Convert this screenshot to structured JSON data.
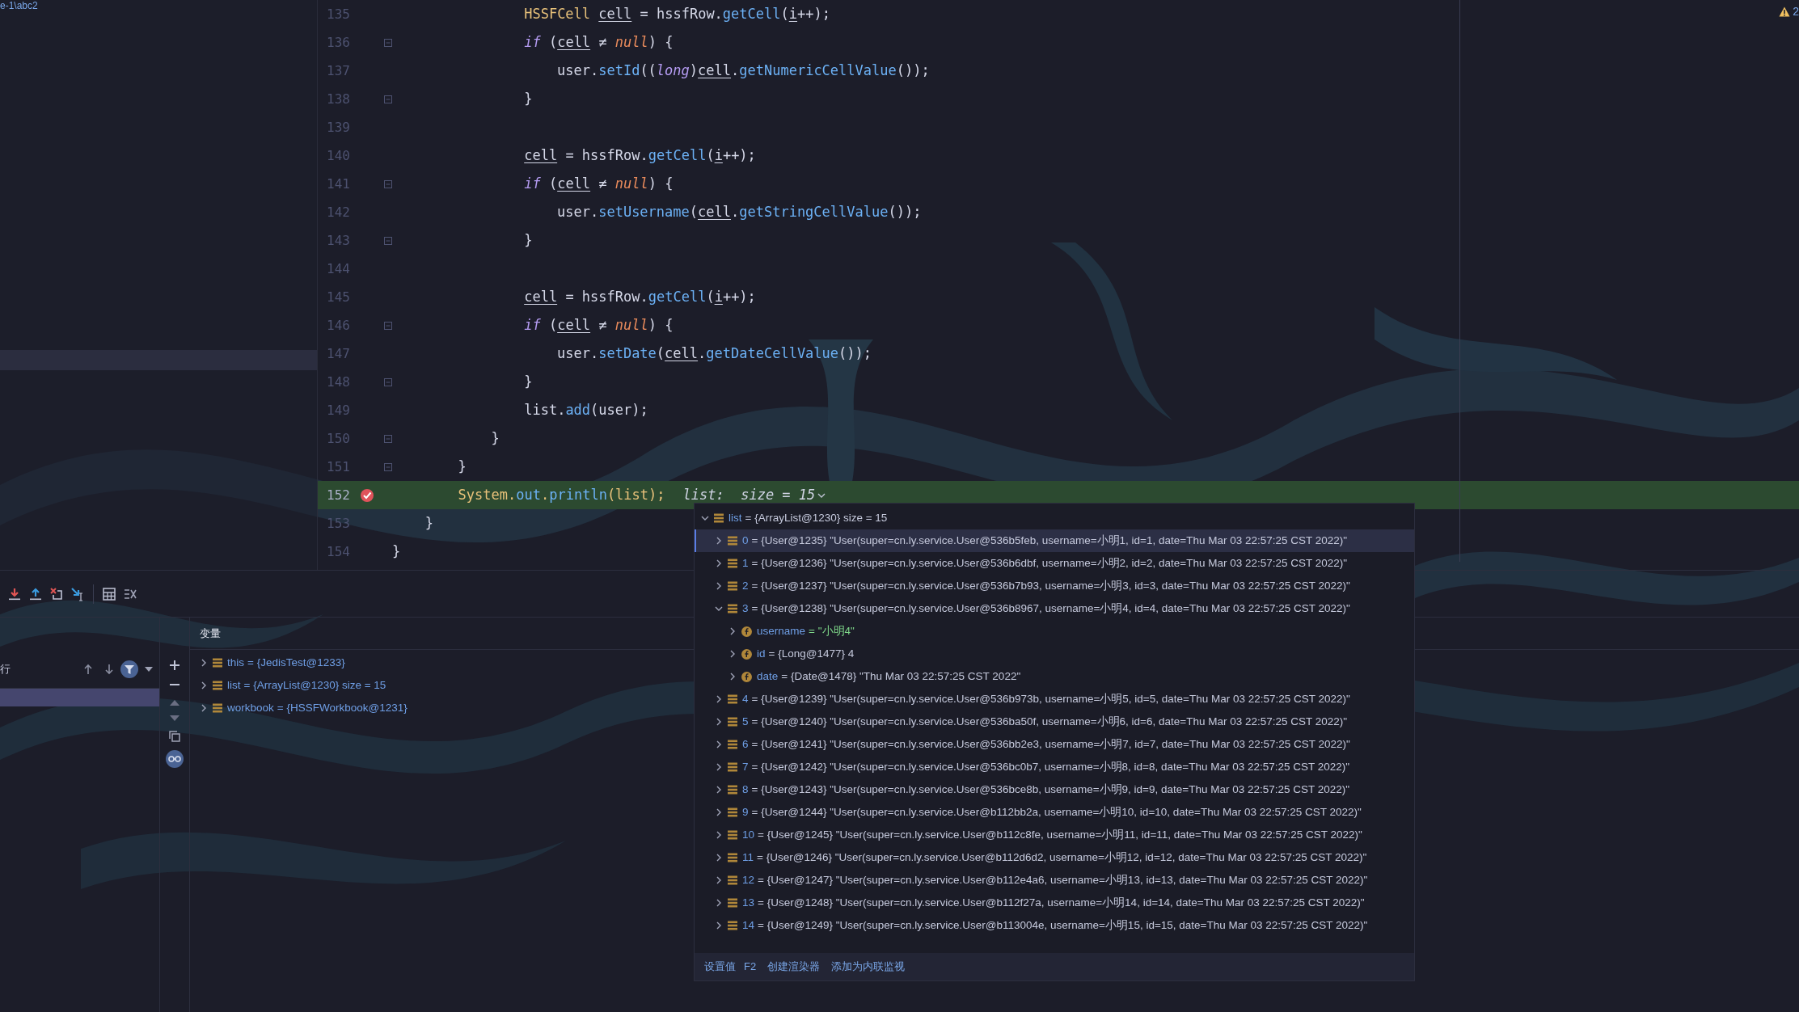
{
  "project_panel": {
    "path_text": "e-1\\abc2"
  },
  "editor": {
    "warning_count": "2",
    "lines": [
      {
        "number": "135",
        "fold": false,
        "breakpoint": false,
        "current": false,
        "tokens": [
          {
            "kind": "type",
            "text": "                HSSFCell "
          },
          {
            "kind": "var",
            "text": "cell"
          },
          {
            "kind": "plain",
            "text": " = hssfRow."
          },
          {
            "kind": "method",
            "text": "getCell"
          },
          {
            "kind": "plain",
            "text": "("
          },
          {
            "kind": "var",
            "text": "i"
          },
          {
            "kind": "plain",
            "text": "++);"
          }
        ]
      },
      {
        "number": "136",
        "fold": true,
        "breakpoint": false,
        "current": false,
        "tokens": [
          {
            "kind": "kw",
            "text": "                if"
          },
          {
            "kind": "plain",
            "text": " ("
          },
          {
            "kind": "var",
            "text": "cell"
          },
          {
            "kind": "plain",
            "text": " ≠ "
          },
          {
            "kind": "null",
            "text": "null"
          },
          {
            "kind": "plain",
            "text": ") {"
          }
        ]
      },
      {
        "number": "137",
        "fold": false,
        "breakpoint": false,
        "current": false,
        "tokens": [
          {
            "kind": "plain",
            "text": "                    user."
          },
          {
            "kind": "method",
            "text": "setId"
          },
          {
            "kind": "plain",
            "text": "(("
          },
          {
            "kind": "kw",
            "text": "long"
          },
          {
            "kind": "plain",
            "text": ")"
          },
          {
            "kind": "var",
            "text": "cell"
          },
          {
            "kind": "plain",
            "text": "."
          },
          {
            "kind": "method",
            "text": "getNumericCellValue"
          },
          {
            "kind": "plain",
            "text": "());"
          }
        ]
      },
      {
        "number": "138",
        "fold": true,
        "breakpoint": false,
        "current": false,
        "tokens": [
          {
            "kind": "plain",
            "text": "                }"
          }
        ]
      },
      {
        "number": "139",
        "fold": false,
        "breakpoint": false,
        "current": false
      },
      {
        "number": "140",
        "fold": false,
        "breakpoint": false,
        "current": false,
        "tokens": [
          {
            "kind": "var",
            "text": "                cell"
          },
          {
            "kind": "plain",
            "text": " = hssfRow."
          },
          {
            "kind": "method",
            "text": "getCell"
          },
          {
            "kind": "plain",
            "text": "("
          },
          {
            "kind": "var",
            "text": "i"
          },
          {
            "kind": "plain",
            "text": "++);"
          }
        ]
      },
      {
        "number": "141",
        "fold": true,
        "breakpoint": false,
        "current": false,
        "tokens": [
          {
            "kind": "kw",
            "text": "                if"
          },
          {
            "kind": "plain",
            "text": " ("
          },
          {
            "kind": "var",
            "text": "cell"
          },
          {
            "kind": "plain",
            "text": " ≠ "
          },
          {
            "kind": "null",
            "text": "null"
          },
          {
            "kind": "plain",
            "text": ") {"
          }
        ]
      },
      {
        "number": "142",
        "fold": false,
        "breakpoint": false,
        "current": false,
        "tokens": [
          {
            "kind": "plain",
            "text": "                    user."
          },
          {
            "kind": "method",
            "text": "setUsername"
          },
          {
            "kind": "plain",
            "text": "("
          },
          {
            "kind": "var",
            "text": "cell"
          },
          {
            "kind": "plain",
            "text": "."
          },
          {
            "kind": "method",
            "text": "getStringCellValue"
          },
          {
            "kind": "plain",
            "text": "());"
          }
        ]
      },
      {
        "number": "143",
        "fold": true,
        "breakpoint": false,
        "current": false,
        "tokens": [
          {
            "kind": "plain",
            "text": "                }"
          }
        ]
      },
      {
        "number": "144",
        "fold": false,
        "breakpoint": false,
        "current": false
      },
      {
        "number": "145",
        "fold": false,
        "breakpoint": false,
        "current": false,
        "tokens": [
          {
            "kind": "var",
            "text": "                cell"
          },
          {
            "kind": "plain",
            "text": " = hssfRow."
          },
          {
            "kind": "method",
            "text": "getCell"
          },
          {
            "kind": "plain",
            "text": "("
          },
          {
            "kind": "var",
            "text": "i"
          },
          {
            "kind": "plain",
            "text": "++);"
          }
        ]
      },
      {
        "number": "146",
        "fold": true,
        "breakpoint": false,
        "current": false,
        "tokens": [
          {
            "kind": "kw",
            "text": "                if"
          },
          {
            "kind": "plain",
            "text": " ("
          },
          {
            "kind": "var",
            "text": "cell"
          },
          {
            "kind": "plain",
            "text": " ≠ "
          },
          {
            "kind": "null",
            "text": "null"
          },
          {
            "kind": "plain",
            "text": ") {"
          }
        ]
      },
      {
        "number": "147",
        "fold": false,
        "breakpoint": false,
        "current": false,
        "tokens": [
          {
            "kind": "plain",
            "text": "                    user."
          },
          {
            "kind": "method",
            "text": "setDate"
          },
          {
            "kind": "plain",
            "text": "("
          },
          {
            "kind": "var",
            "text": "cell"
          },
          {
            "kind": "plain",
            "text": "."
          },
          {
            "kind": "method",
            "text": "getDateCellValue"
          },
          {
            "kind": "plain",
            "text": "());"
          }
        ]
      },
      {
        "number": "148",
        "fold": true,
        "breakpoint": false,
        "current": false,
        "tokens": [
          {
            "kind": "plain",
            "text": "                }"
          }
        ]
      },
      {
        "number": "149",
        "fold": false,
        "breakpoint": false,
        "current": false,
        "tokens": [
          {
            "kind": "plain",
            "text": "                list."
          },
          {
            "kind": "method",
            "text": "add"
          },
          {
            "kind": "plain",
            "text": "(user);"
          }
        ]
      },
      {
        "number": "150",
        "fold": true,
        "breakpoint": false,
        "current": false,
        "tokens": [
          {
            "kind": "plain",
            "text": "            }"
          }
        ]
      },
      {
        "number": "151",
        "fold": true,
        "breakpoint": false,
        "current": false,
        "tokens": [
          {
            "kind": "plain",
            "text": "        }"
          }
        ]
      },
      {
        "number": "152",
        "fold": false,
        "breakpoint": true,
        "current": true,
        "hint": "list:  size = 15",
        "tokens": [
          {
            "kind": "type",
            "text": "        System."
          },
          {
            "kind": "method",
            "text": "out"
          },
          {
            "kind": "type",
            "text": "."
          },
          {
            "kind": "method",
            "text": "println"
          },
          {
            "kind": "type",
            "text": "(list);"
          }
        ]
      },
      {
        "number": "153",
        "fold": false,
        "breakpoint": false,
        "current": false,
        "tokens": [
          {
            "kind": "plain",
            "text": "    }"
          }
        ]
      },
      {
        "number": "154",
        "fold": false,
        "breakpoint": false,
        "current": false,
        "tokens": [
          {
            "kind": "plain",
            "text": "}"
          }
        ]
      }
    ]
  },
  "debugger": {
    "frames_header": "行",
    "variables_title": "变量",
    "variables": [
      {
        "name": "this",
        "value": "= {JedisTest@1233}",
        "kind": "object",
        "expanded": false
      },
      {
        "name": "list",
        "value": "= {ArrayList@1230}  size = 15",
        "kind": "object",
        "expanded": false
      },
      {
        "name": "workbook",
        "value": "= {HSSFWorkbook@1231}",
        "kind": "object",
        "expanded": false
      }
    ]
  },
  "popup": {
    "tree": [
      {
        "name": "list",
        "value": "= {ArrayList@1230}  size = 15",
        "kind": "object",
        "expanded": true,
        "selected": false,
        "children": [
          {
            "name": "0",
            "value": "= {User@1235} \"User(super=cn.ly.service.User@536b5feb, username=小明1, id=1, date=Thu Mar 03 22:57:25 CST 2022)\"",
            "kind": "object",
            "expanded": false,
            "selected": true
          },
          {
            "name": "1",
            "value": "= {User@1236} \"User(super=cn.ly.service.User@536b6dbf, username=小明2, id=2, date=Thu Mar 03 22:57:25 CST 2022)\"",
            "kind": "object",
            "expanded": false,
            "selected": false
          },
          {
            "name": "2",
            "value": "= {User@1237} \"User(super=cn.ly.service.User@536b7b93, username=小明3, id=3, date=Thu Mar 03 22:57:25 CST 2022)\"",
            "kind": "object",
            "expanded": false,
            "selected": false
          },
          {
            "name": "3",
            "value": "= {User@1238} \"User(super=cn.ly.service.User@536b8967, username=小明4, id=4, date=Thu Mar 03 22:57:25 CST 2022)\"",
            "kind": "object",
            "expanded": true,
            "selected": false,
            "children": [
              {
                "name": "username",
                "value": "= \"小明4\"",
                "kind": "field",
                "string_literal": true,
                "expanded": false,
                "selected": false
              },
              {
                "name": "id",
                "value": "= {Long@1477} 4",
                "kind": "field",
                "string_literal": false,
                "expanded": false,
                "selected": false
              },
              {
                "name": "date",
                "value": "= {Date@1478} \"Thu Mar 03 22:57:25 CST 2022\"",
                "kind": "field",
                "string_literal": false,
                "expanded": false,
                "selected": false
              }
            ]
          },
          {
            "name": "4",
            "value": "= {User@1239} \"User(super=cn.ly.service.User@536b973b, username=小明5, id=5, date=Thu Mar 03 22:57:25 CST 2022)\"",
            "kind": "object",
            "expanded": false,
            "selected": false
          },
          {
            "name": "5",
            "value": "= {User@1240} \"User(super=cn.ly.service.User@536ba50f, username=小明6, id=6, date=Thu Mar 03 22:57:25 CST 2022)\"",
            "kind": "object",
            "expanded": false,
            "selected": false
          },
          {
            "name": "6",
            "value": "= {User@1241} \"User(super=cn.ly.service.User@536bb2e3, username=小明7, id=7, date=Thu Mar 03 22:57:25 CST 2022)\"",
            "kind": "object",
            "expanded": false,
            "selected": false
          },
          {
            "name": "7",
            "value": "= {User@1242} \"User(super=cn.ly.service.User@536bc0b7, username=小明8, id=8, date=Thu Mar 03 22:57:25 CST 2022)\"",
            "kind": "object",
            "expanded": false,
            "selected": false
          },
          {
            "name": "8",
            "value": "= {User@1243} \"User(super=cn.ly.service.User@536bce8b, username=小明9, id=9, date=Thu Mar 03 22:57:25 CST 2022)\"",
            "kind": "object",
            "expanded": false,
            "selected": false
          },
          {
            "name": "9",
            "value": "= {User@1244} \"User(super=cn.ly.service.User@b112bb2a, username=小明10, id=10, date=Thu Mar 03 22:57:25 CST 2022)\"",
            "kind": "object",
            "expanded": false,
            "selected": false
          },
          {
            "name": "10",
            "value": "= {User@1245} \"User(super=cn.ly.service.User@b112c8fe, username=小明11, id=11, date=Thu Mar 03 22:57:25 CST 2022)\"",
            "kind": "object",
            "expanded": false,
            "selected": false
          },
          {
            "name": "11",
            "value": "= {User@1246} \"User(super=cn.ly.service.User@b112d6d2, username=小明12, id=12, date=Thu Mar 03 22:57:25 CST 2022)\"",
            "kind": "object",
            "expanded": false,
            "selected": false
          },
          {
            "name": "12",
            "value": "= {User@1247} \"User(super=cn.ly.service.User@b112e4a6, username=小明13, id=13, date=Thu Mar 03 22:57:25 CST 2022)\"",
            "kind": "object",
            "expanded": false,
            "selected": false
          },
          {
            "name": "13",
            "value": "= {User@1248} \"User(super=cn.ly.service.User@b112f27a, username=小明14, id=14, date=Thu Mar 03 22:57:25 CST 2022)\"",
            "kind": "object",
            "expanded": false,
            "selected": false
          },
          {
            "name": "14",
            "value": "= {User@1249} \"User(super=cn.ly.service.User@b113004e, username=小明15, id=15, date=Thu Mar 03 22:57:25 CST 2022)\"",
            "kind": "object",
            "expanded": false,
            "selected": false
          }
        ]
      }
    ],
    "actions": [
      {
        "label": "设置值",
        "shortcut": "F2"
      },
      {
        "label": "创建渲染器"
      },
      {
        "label": "添加为内联监视"
      }
    ]
  }
}
